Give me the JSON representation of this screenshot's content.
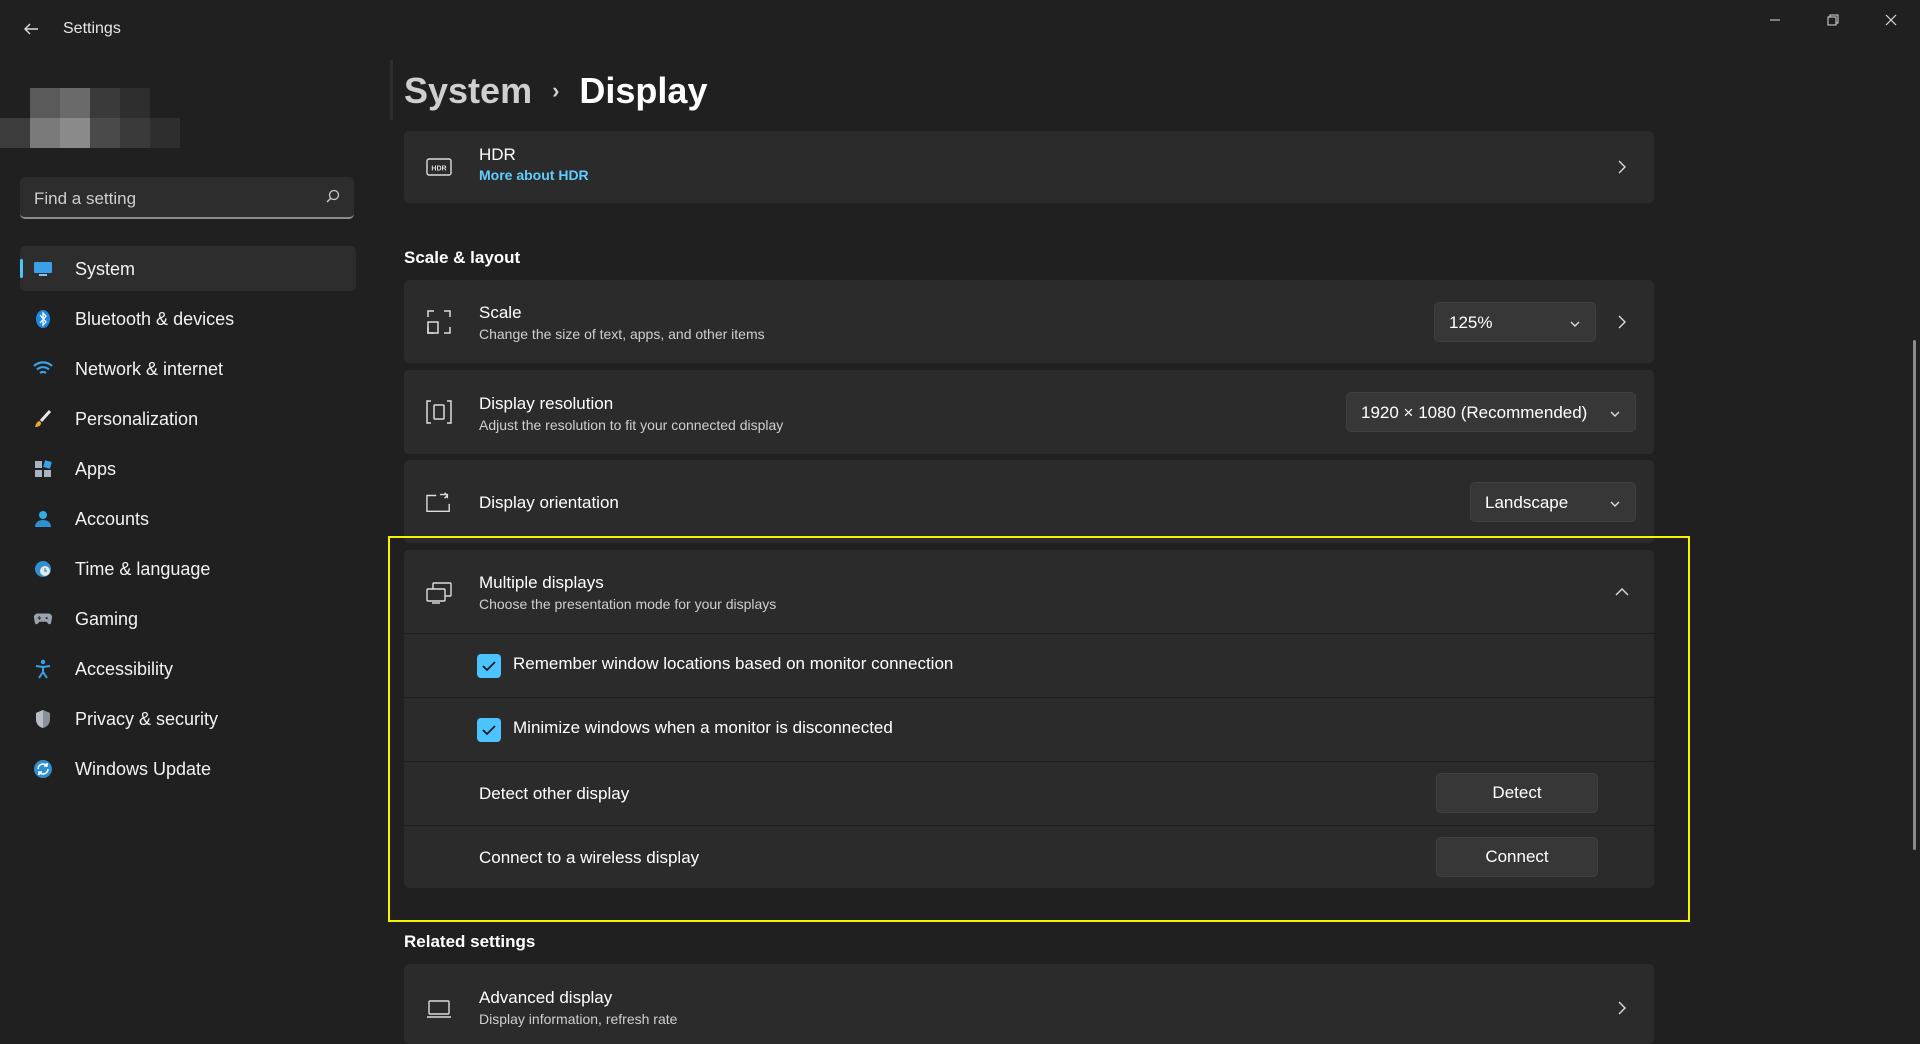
{
  "window": {
    "title": "Settings"
  },
  "search": {
    "placeholder": "Find a setting"
  },
  "sidebar": {
    "items": [
      {
        "label": "System",
        "icon": "monitor-icon",
        "active": true
      },
      {
        "label": "Bluetooth & devices",
        "icon": "bluetooth-icon"
      },
      {
        "label": "Network & internet",
        "icon": "wifi-icon"
      },
      {
        "label": "Personalization",
        "icon": "brush-icon"
      },
      {
        "label": "Apps",
        "icon": "apps-icon"
      },
      {
        "label": "Accounts",
        "icon": "person-icon"
      },
      {
        "label": "Time & language",
        "icon": "clock-globe-icon"
      },
      {
        "label": "Gaming",
        "icon": "gamepad-icon"
      },
      {
        "label": "Accessibility",
        "icon": "accessibility-icon"
      },
      {
        "label": "Privacy & security",
        "icon": "shield-icon"
      },
      {
        "label": "Windows Update",
        "icon": "update-icon"
      }
    ]
  },
  "breadcrumb": {
    "parent": "System",
    "separator": "›",
    "current": "Display"
  },
  "hdr": {
    "title": "HDR",
    "link": "More about HDR",
    "icon": "hdr-icon"
  },
  "scale_layout": {
    "heading": "Scale & layout",
    "scale": {
      "title": "Scale",
      "subtitle": "Change the size of text, apps, and other items",
      "value": "125%",
      "icon": "scale-icon"
    },
    "resolution": {
      "title": "Display resolution",
      "subtitle": "Adjust the resolution to fit your connected display",
      "value": "1920 × 1080 (Recommended)",
      "icon": "resolution-icon"
    },
    "orientation": {
      "title": "Display orientation",
      "value": "Landscape",
      "icon": "orientation-icon"
    }
  },
  "multiple_displays": {
    "title": "Multiple displays",
    "subtitle": "Choose the presentation mode for your displays",
    "icon": "multiple-displays-icon",
    "remember_label": "Remember window locations based on monitor connection",
    "remember_checked": true,
    "minimize_label": "Minimize windows when a monitor is disconnected",
    "minimize_checked": true,
    "detect_label": "Detect other display",
    "detect_button": "Detect",
    "connect_label": "Connect to a wireless display",
    "connect_button": "Connect"
  },
  "related": {
    "heading": "Related settings",
    "advanced_title": "Advanced display",
    "advanced_sub": "Display information, refresh rate",
    "icon": "laptop-icon"
  },
  "colors": {
    "accent": "#4cc2ff",
    "link": "#60cdff",
    "highlight": "#f5f500",
    "background": "#202020",
    "card": "#2b2b2b"
  }
}
